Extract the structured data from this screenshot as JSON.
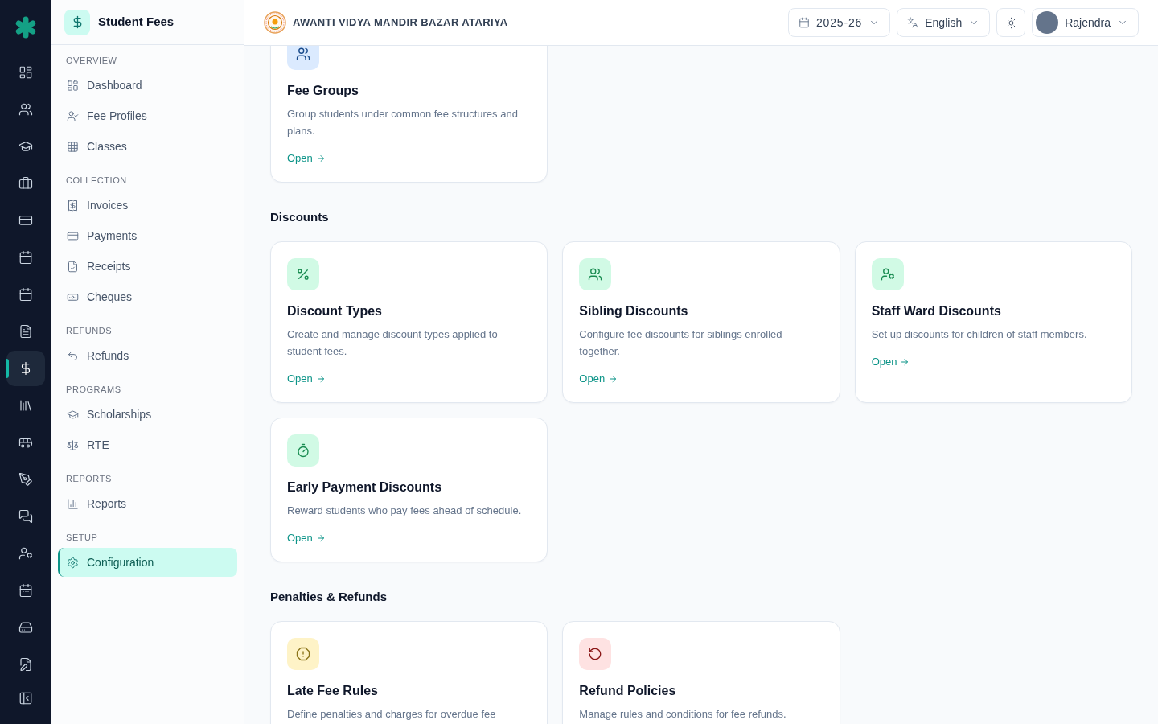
{
  "icon_rail": {
    "items": [
      {
        "selected": false
      },
      {
        "selected": false
      },
      {
        "selected": false
      },
      {
        "selected": false
      },
      {
        "selected": false
      },
      {
        "selected": false
      },
      {
        "selected": false
      },
      {
        "selected": false
      },
      {
        "selected": true
      },
      {
        "selected": false
      },
      {
        "selected": false
      },
      {
        "selected": false
      },
      {
        "selected": false
      },
      {
        "selected": false
      },
      {
        "selected": false
      },
      {
        "selected": false
      },
      {
        "selected": false
      }
    ]
  },
  "sidebar": {
    "title": "Student Fees",
    "sections": [
      {
        "label": "OVERVIEW",
        "items": [
          {
            "label": "Dashboard",
            "selected": false
          },
          {
            "label": "Fee Profiles",
            "selected": false
          },
          {
            "label": "Classes",
            "selected": false
          }
        ]
      },
      {
        "label": "COLLECTION",
        "items": [
          {
            "label": "Invoices",
            "selected": false
          },
          {
            "label": "Payments",
            "selected": false
          },
          {
            "label": "Receipts",
            "selected": false
          },
          {
            "label": "Cheques",
            "selected": false
          }
        ]
      },
      {
        "label": "REFUNDS",
        "items": [
          {
            "label": "Refunds",
            "selected": false
          }
        ]
      },
      {
        "label": "PROGRAMS",
        "items": [
          {
            "label": "Scholarships",
            "selected": false
          },
          {
            "label": "RTE",
            "selected": false
          }
        ]
      },
      {
        "label": "REPORTS",
        "items": [
          {
            "label": "Reports",
            "selected": false
          }
        ]
      },
      {
        "label": "SETUP",
        "items": [
          {
            "label": "Configuration",
            "selected": true
          }
        ]
      }
    ]
  },
  "header": {
    "school_name": "AWANTI VIDYA MANDIR BAZAR ATARIYA",
    "academic_year": "2025-26",
    "language": "English",
    "user_name": "Rajendra"
  },
  "content": {
    "sections": [
      {
        "cards": [
          {
            "title": "Fee Groups",
            "description": "Group students under common fee structures and plans.",
            "link": "Open",
            "color": "#dbeafe"
          }
        ]
      },
      {
        "heading": "Discounts",
        "cards": [
          {
            "title": "Discount Types",
            "description": "Create and manage discount types applied to student fees.",
            "link": "Open",
            "color": "#d1fae5"
          },
          {
            "title": "Sibling Discounts",
            "description": "Configure fee discounts for siblings enrolled together.",
            "link": "Open",
            "color": "#d1fae5"
          },
          {
            "title": "Staff Ward Discounts",
            "description": "Set up discounts for children of staff members.",
            "link": "Open",
            "color": "#d1fae5"
          },
          {
            "title": "Early Payment Discounts",
            "description": "Reward students who pay fees ahead of schedule.",
            "link": "Open",
            "color": "#d1fae5"
          }
        ]
      },
      {
        "heading": "Penalties & Refunds",
        "cards": [
          {
            "title": "Late Fee Rules",
            "description": "Define penalties and charges for overdue fee",
            "color": "#fef3c7"
          },
          {
            "title": "Refund Policies",
            "description": "Manage rules and conditions for fee refunds.",
            "color": "#fee2e2"
          }
        ]
      }
    ]
  }
}
